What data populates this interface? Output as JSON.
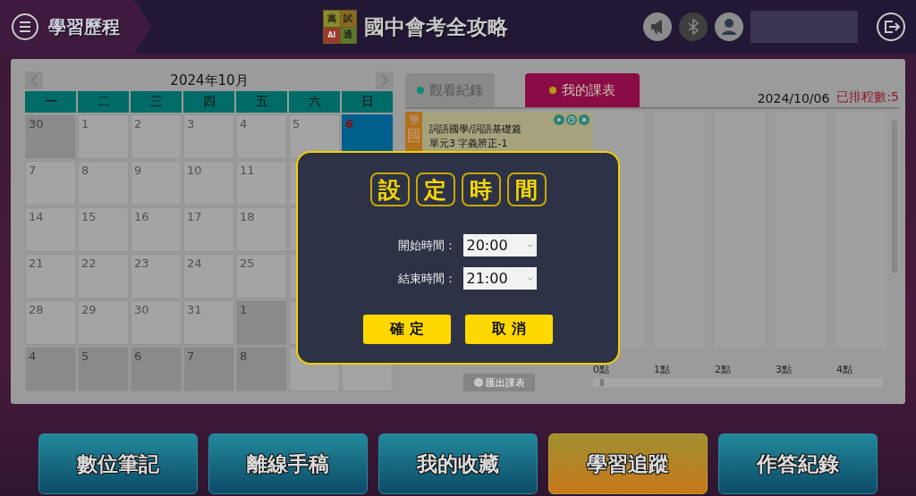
{
  "header": {
    "section": "學習歷程",
    "logo_chars": [
      "萬",
      "試",
      "AI",
      "通"
    ],
    "title": "國中會考全攻略"
  },
  "calendar": {
    "month": "2024年10月",
    "weekdays": [
      "一",
      "二",
      "三",
      "四",
      "五",
      "六",
      "日"
    ],
    "weeks": [
      [
        {
          "day": "30",
          "in_month": false,
          "selected": false
        },
        {
          "day": "1",
          "in_month": true,
          "selected": false
        },
        {
          "day": "2",
          "in_month": true,
          "selected": false
        },
        {
          "day": "3",
          "in_month": true,
          "selected": false
        },
        {
          "day": "4",
          "in_month": true,
          "selected": false
        },
        {
          "day": "5",
          "in_month": true,
          "selected": false
        },
        {
          "day": "6",
          "in_month": true,
          "selected": true
        }
      ],
      [
        {
          "day": "7",
          "in_month": true,
          "selected": false
        },
        {
          "day": "8",
          "in_month": true,
          "selected": false
        },
        {
          "day": "9",
          "in_month": true,
          "selected": false
        },
        {
          "day": "10",
          "in_month": true,
          "selected": false
        },
        {
          "day": "11",
          "in_month": true,
          "selected": false
        }
      ],
      [
        {
          "day": "14",
          "in_month": true,
          "selected": false
        },
        {
          "day": "15",
          "in_month": true,
          "selected": false
        },
        {
          "day": "16",
          "in_month": true,
          "selected": false
        },
        {
          "day": "17",
          "in_month": true,
          "selected": false
        },
        {
          "day": "18",
          "in_month": true,
          "selected": false
        }
      ],
      [
        {
          "day": "21",
          "in_month": true,
          "selected": false
        },
        {
          "day": "22",
          "in_month": true,
          "selected": false
        },
        {
          "day": "23",
          "in_month": true,
          "selected": false
        },
        {
          "day": "24",
          "in_month": true,
          "selected": false
        },
        {
          "day": "25",
          "in_month": true,
          "selected": false
        }
      ],
      [
        {
          "day": "28",
          "in_month": true,
          "selected": false
        },
        {
          "day": "29",
          "in_month": true,
          "selected": false
        },
        {
          "day": "30",
          "in_month": true,
          "selected": false
        },
        {
          "day": "31",
          "in_month": true,
          "selected": false
        },
        {
          "day": "1",
          "in_month": false,
          "selected": false
        }
      ],
      [
        {
          "day": "4",
          "in_month": false,
          "selected": false
        },
        {
          "day": "5",
          "in_month": false,
          "selected": false
        },
        {
          "day": "6",
          "in_month": false,
          "selected": false
        },
        {
          "day": "7",
          "in_month": false,
          "selected": false
        },
        {
          "day": "8",
          "in_month": false,
          "selected": false
        }
      ]
    ]
  },
  "tabs": [
    {
      "label": "觀看紀錄",
      "selected": false
    },
    {
      "label": "我的課表",
      "selected": true
    }
  ],
  "schedule": {
    "date": "2024/10/06",
    "count": "已排程數:5",
    "entry": {
      "subject": "國",
      "title": "詞語國學/詞語基礎篇",
      "unit": "單元3 字義辨正-1"
    },
    "export_button": "匯出課表",
    "hours": [
      "0點",
      "1點",
      "2點",
      "3點",
      "4點"
    ]
  },
  "dialog": {
    "title_chars": [
      "設",
      "定",
      "時",
      "間"
    ],
    "fields": [
      {
        "label": "開始時間：",
        "value": "20:00"
      },
      {
        "label": "結束時間：",
        "value": "21:00"
      }
    ],
    "buttons": [
      "確 定",
      "取 消"
    ]
  },
  "nav": [
    {
      "label": "數位筆記",
      "selected": false
    },
    {
      "label": "離線手稿",
      "selected": false
    },
    {
      "label": "我的收藏",
      "selected": false
    },
    {
      "label": "學習追蹤",
      "selected": true
    },
    {
      "label": "作答紀錄",
      "selected": false
    }
  ]
}
